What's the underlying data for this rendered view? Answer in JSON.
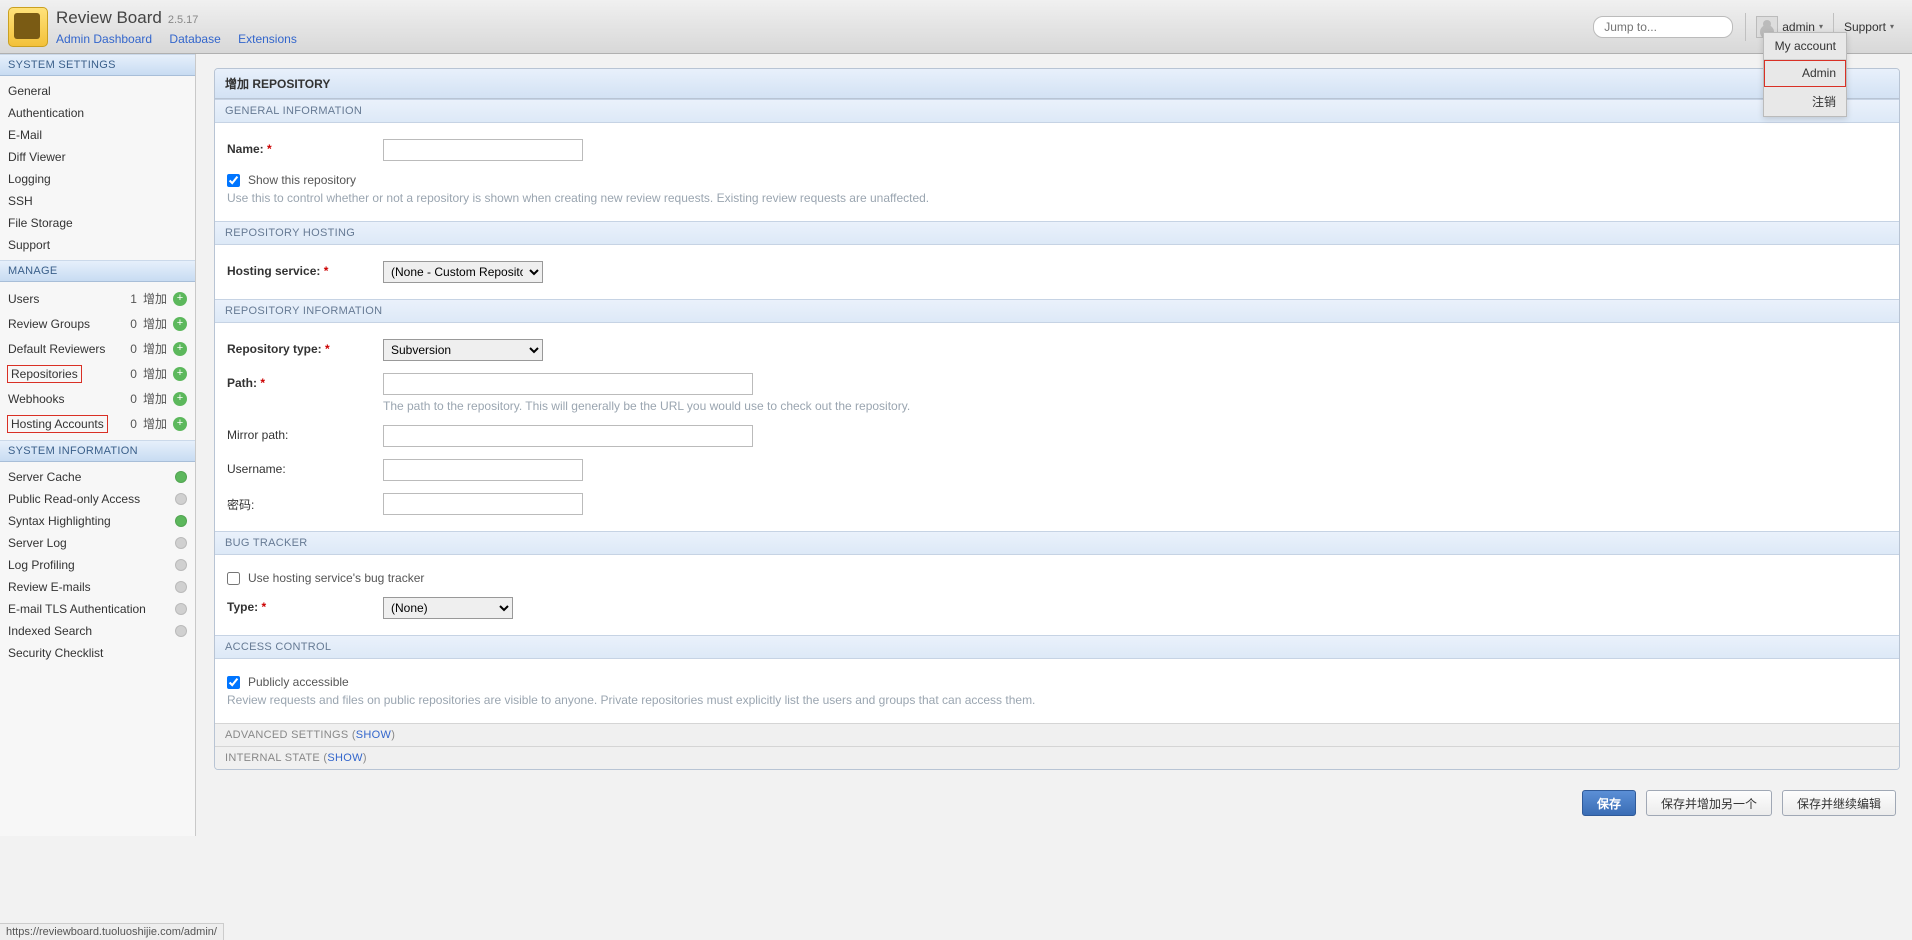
{
  "header": {
    "app_title": "Review Board",
    "app_version": "2.5.17",
    "nav": {
      "admin_dashboard": "Admin Dashboard",
      "database": "Database",
      "extensions": "Extensions"
    },
    "jump_placeholder": "Jump to...",
    "username": "admin",
    "support": "Support",
    "dropdown": {
      "my_account": "My account",
      "admin": "Admin",
      "logout": "注销"
    }
  },
  "sidebar": {
    "system_settings": {
      "title": "SYSTEM SETTINGS",
      "items": [
        "General",
        "Authentication",
        "E-Mail",
        "Diff Viewer",
        "Logging",
        "SSH",
        "File Storage",
        "Support"
      ]
    },
    "manage": {
      "title": "MANAGE",
      "add_label": "增加",
      "items": [
        {
          "label": "Users",
          "count": "1"
        },
        {
          "label": "Review Groups",
          "count": "0"
        },
        {
          "label": "Default Reviewers",
          "count": "0"
        },
        {
          "label": "Repositories",
          "count": "0",
          "highlight": true
        },
        {
          "label": "Webhooks",
          "count": "0"
        },
        {
          "label": "Hosting Accounts",
          "count": "0",
          "highlight": true
        }
      ]
    },
    "system_info": {
      "title": "SYSTEM INFORMATION",
      "items": [
        {
          "label": "Server Cache",
          "status": "green"
        },
        {
          "label": "Public Read-only Access",
          "status": "gray"
        },
        {
          "label": "Syntax Highlighting",
          "status": "green"
        },
        {
          "label": "Server Log",
          "status": "gray"
        },
        {
          "label": "Log Profiling",
          "status": "gray"
        },
        {
          "label": "Review E-mails",
          "status": "gray"
        },
        {
          "label": "E-mail TLS Authentication",
          "status": "gray"
        },
        {
          "label": "Indexed Search",
          "status": "gray"
        },
        {
          "label": "Security Checklist",
          "status": ""
        }
      ]
    }
  },
  "form": {
    "title": "增加 REPOSITORY",
    "sections": {
      "general_info": "GENERAL INFORMATION",
      "repo_hosting": "REPOSITORY HOSTING",
      "repo_info": "REPOSITORY INFORMATION",
      "bug_tracker": "BUG TRACKER",
      "access_control": "ACCESS CONTROL",
      "advanced": "ADVANCED SETTINGS",
      "internal": "INTERNAL STATE",
      "show": "SHOW"
    },
    "labels": {
      "name": "Name:",
      "show_repo": "Show this repository",
      "show_repo_help": "Use this to control whether or not a repository is shown when creating new review requests. Existing review requests are unaffected.",
      "hosting_service": "Hosting service:",
      "hosting_service_value": "(None - Custom Repository)",
      "repo_type": "Repository type:",
      "repo_type_value": "Subversion",
      "path": "Path:",
      "path_help": "The path to the repository. This will generally be the URL you would use to check out the repository.",
      "mirror_path": "Mirror path:",
      "username": "Username:",
      "password": "密码:",
      "use_hosting_bug": "Use hosting service's bug tracker",
      "bug_type": "Type:",
      "bug_type_value": "(None)",
      "public_accessible": "Publicly accessible",
      "public_help": "Review requests and files on public repositories are visible to anyone. Private repositories must explicitly list the users and groups that can access them."
    },
    "buttons": {
      "save": "保存",
      "save_add": "保存并增加另一个",
      "save_continue": "保存并继续编辑"
    }
  },
  "status_url": "https://reviewboard.tuoluoshijie.com/admin/"
}
